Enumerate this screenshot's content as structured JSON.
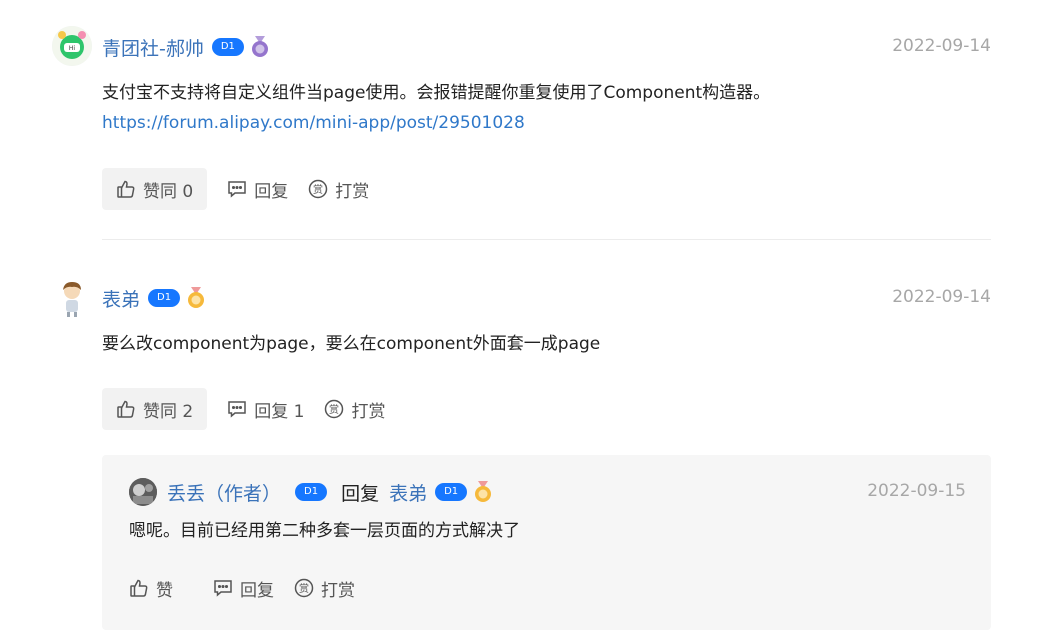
{
  "comments": [
    {
      "username": "青团社-郝帅",
      "level": "D1",
      "date": "2022-09-14",
      "text": "支付宝不支持将自定义组件当page使用。会报错提醒你重复使用了Component构造器。",
      "link": "https://forum.alipay.com/mini-app/post/29501028",
      "like_label": "赞同 0",
      "reply_label": "回复",
      "reward_label": "打赏"
    },
    {
      "username": "表弟",
      "level": "D1",
      "date": "2022-09-14",
      "text": "要么改component为page，要么在component外面套一成page",
      "like_label": "赞同 2",
      "reply_label": "回复 1",
      "reward_label": "打赏"
    }
  ],
  "reply": {
    "username": "丢丢（作者）",
    "level": "D1",
    "reply_word": "回复",
    "target_user": "表弟",
    "target_level": "D1",
    "date": "2022-09-15",
    "text": "嗯呢。目前已经用第二种多套一层页面的方式解决了",
    "like_label": "赞",
    "reply_label": "回复",
    "reward_label": "打赏"
  },
  "colors": {
    "accent": "#1677ff",
    "username": "#3b73b9",
    "link": "#2f78c9"
  },
  "icons": [
    "thumb-up-icon",
    "comment-icon",
    "reward-icon",
    "medal-icon"
  ]
}
